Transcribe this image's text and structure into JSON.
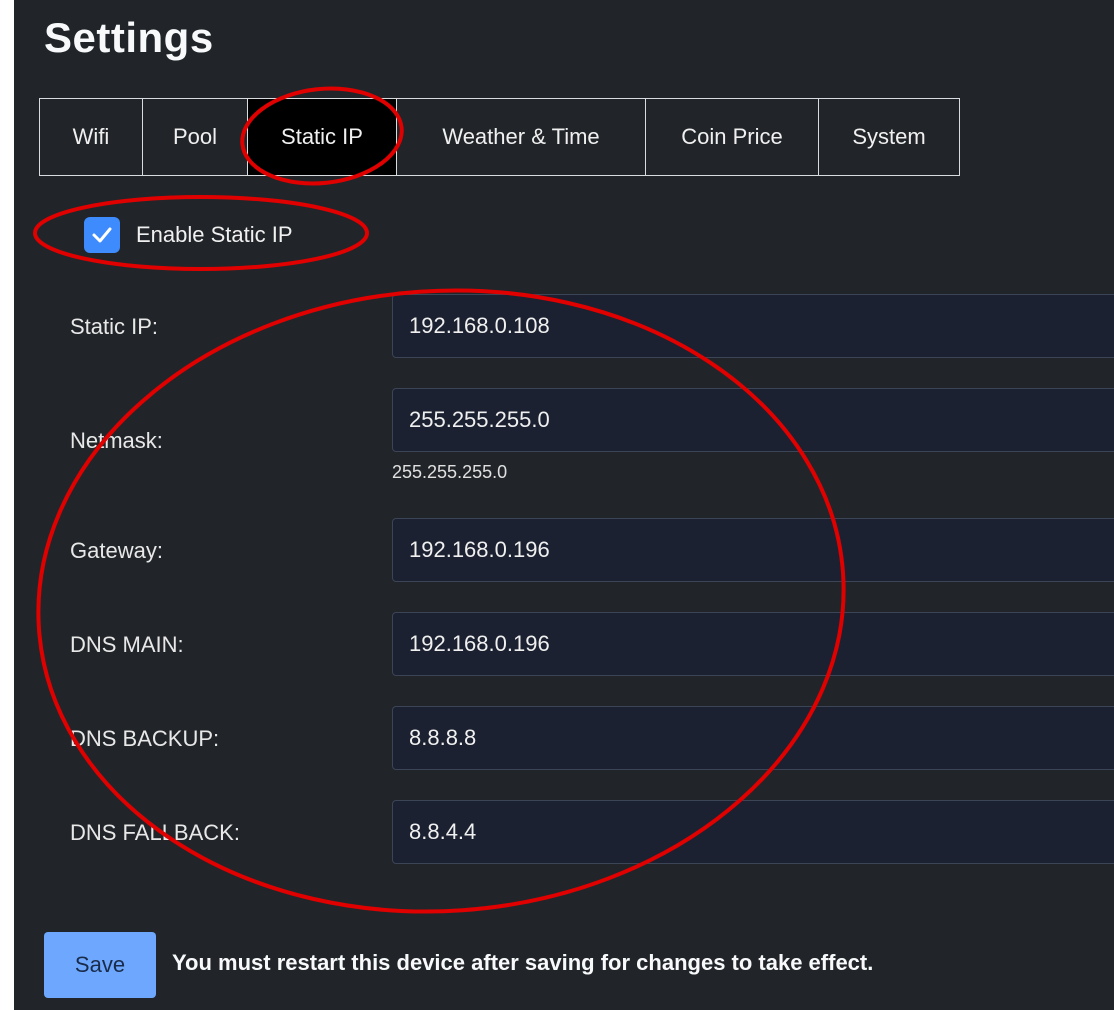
{
  "page": {
    "title": "Settings"
  },
  "tabs": [
    {
      "label": "Wifi"
    },
    {
      "label": "Pool"
    },
    {
      "label": "Static IP",
      "active": true
    },
    {
      "label": "Weather & Time"
    },
    {
      "label": "Coin Price"
    },
    {
      "label": "System"
    }
  ],
  "enable_static_ip": {
    "label": "Enable Static IP",
    "checked": true
  },
  "fields": {
    "static_ip": {
      "label": "Static IP:",
      "value": "192.168.0.108"
    },
    "netmask": {
      "label": "Netmask:",
      "value": "255.255.255.0",
      "help": "255.255.255.0"
    },
    "gateway": {
      "label": "Gateway:",
      "value": "192.168.0.196"
    },
    "dns_main": {
      "label": "DNS MAIN:",
      "value": "192.168.0.196"
    },
    "dns_backup": {
      "label": "DNS BACKUP:",
      "value": "8.8.8.8"
    },
    "dns_fallback": {
      "label": "DNS FALLBACK:",
      "value": "8.8.4.4"
    }
  },
  "footer": {
    "save_label": "Save",
    "restart_note": "You must restart this device after saving for changes to take effect."
  },
  "colors": {
    "panel_bg": "#212529",
    "accent": "#3d8bfd",
    "save_button": "#6ea8fe",
    "annotation": "#e00000"
  }
}
